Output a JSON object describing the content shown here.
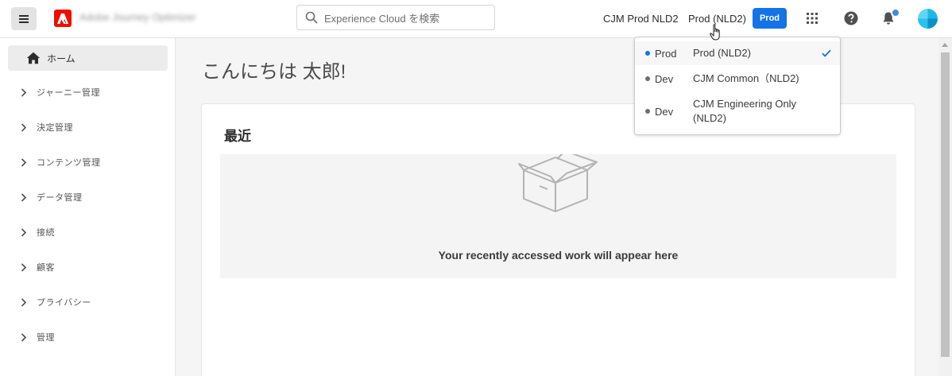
{
  "header": {
    "app_name": "Adobe Journey Optimizer",
    "search_placeholder": "Experience Cloud を検索",
    "org_name": "CJM Prod NLD2",
    "sandbox_name": "Prod (NLD2)",
    "sandbox_badge": "Prod",
    "icons": [
      "menu-icon",
      "adobe-logo-icon",
      "search-icon",
      "apps-grid-icon",
      "help-icon",
      "bell-icon",
      "avatar"
    ]
  },
  "sidebar": {
    "home_label": "ホーム",
    "items": [
      {
        "label": "ジャーニー管理"
      },
      {
        "label": "決定管理"
      },
      {
        "label": "コンテンツ管理"
      },
      {
        "label": "データ管理"
      },
      {
        "label": "接続"
      },
      {
        "label": "顧客"
      },
      {
        "label": "プライバシー"
      },
      {
        "label": "管理"
      }
    ]
  },
  "main": {
    "greeting": "こんにちは 太郎!",
    "recent": {
      "title": "最近",
      "empty_text": "Your recently accessed work will appear here"
    }
  },
  "sandbox_dropdown": {
    "options": [
      {
        "type": "Prod",
        "name": "Prod (NLD2)",
        "selected": true,
        "dot_color": "#1473e6"
      },
      {
        "type": "Dev",
        "name": "CJM Common（NLD2)",
        "selected": false,
        "dot_color": "#6e6e6e"
      },
      {
        "type": "Dev",
        "name": "CJM Engineering Only (NLD2)",
        "selected": false,
        "dot_color": "#6e6e6e"
      }
    ]
  },
  "colors": {
    "accent": "#1473e6",
    "adobe_red": "#eb1000",
    "notification": "#3b8de6"
  }
}
